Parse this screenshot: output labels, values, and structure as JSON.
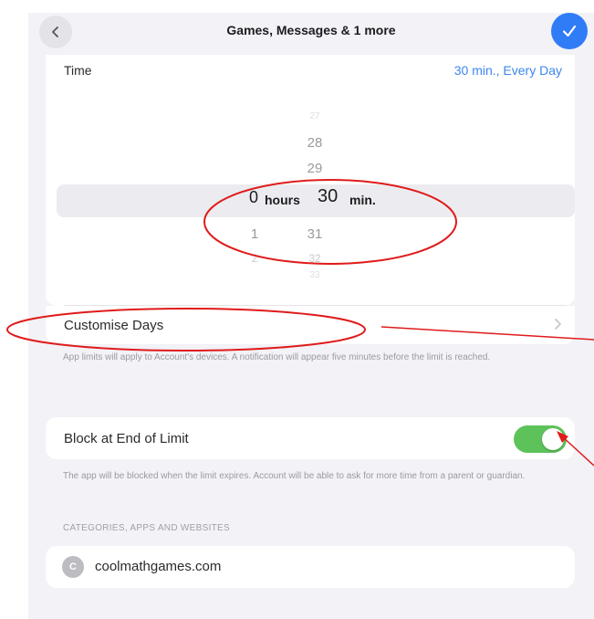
{
  "nav": {
    "title": "Games, Messages & 1 more",
    "back_icon": "chevron-left-icon",
    "done_icon": "checkmark-icon"
  },
  "time": {
    "label": "Time",
    "value": "30 min., Every Day"
  },
  "picker": {
    "hours_selected": "0",
    "hours_unit": "hours",
    "hours_below": [
      "1",
      "2"
    ],
    "minutes_selected": "30",
    "minutes_unit": "min.",
    "minutes_above": [
      "27",
      "28",
      "29"
    ],
    "minutes_below": [
      "31",
      "32",
      "33"
    ]
  },
  "customise_days": {
    "label": "Customise Days",
    "footnote": "App limits will apply to Account's devices. A notification will appear five minutes before the limit is reached."
  },
  "block": {
    "label": "Block at End of Limit",
    "enabled": true,
    "footnote": "The app will be blocked when the limit expires. Account will be able to ask for more time from a parent or guardian."
  },
  "categories": {
    "header": "CATEGORIES, APPS AND WEBSITES",
    "items": [
      {
        "initial": "C",
        "label": "coolmathgames.com"
      }
    ]
  },
  "colors": {
    "accent": "#2f7cf6",
    "link": "#3d86ef",
    "toggle_on": "#5ec25b",
    "annotation": "#e01b1b",
    "background": "#f2f2f7"
  }
}
